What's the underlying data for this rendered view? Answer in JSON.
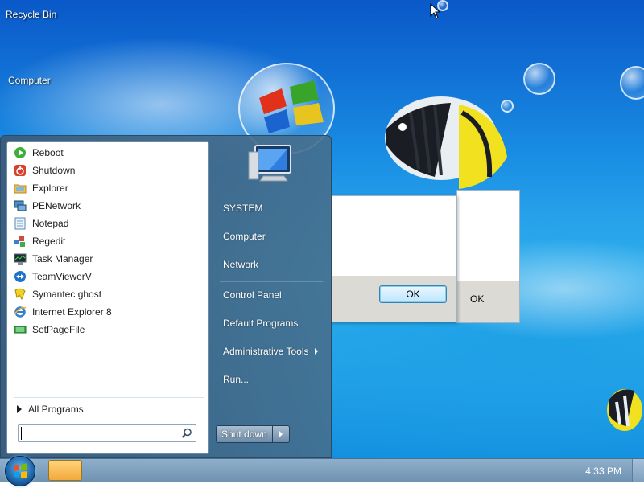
{
  "desktop": {
    "icons": [
      {
        "label": "Recycle Bin"
      },
      {
        "label": "Computer"
      }
    ]
  },
  "start_menu": {
    "programs": [
      {
        "label": "Reboot",
        "icon": "reboot-icon"
      },
      {
        "label": "Shutdown",
        "icon": "shutdown-icon"
      },
      {
        "label": "Explorer",
        "icon": "explorer-folder-icon"
      },
      {
        "label": "PENetwork",
        "icon": "network-icon"
      },
      {
        "label": "Notepad",
        "icon": "notepad-icon"
      },
      {
        "label": "Regedit",
        "icon": "regedit-icon"
      },
      {
        "label": "Task Manager",
        "icon": "task-manager-icon"
      },
      {
        "label": "TeamViewerV",
        "icon": "teamviewer-icon"
      },
      {
        "label": "Symantec ghost",
        "icon": "ghost-icon"
      },
      {
        "label": "Internet Explorer 8",
        "icon": "internet-explorer-icon"
      },
      {
        "label": "SetPageFile",
        "icon": "setpagefile-icon"
      }
    ],
    "all_programs_label": "All Programs",
    "search": {
      "value": "",
      "placeholder": ""
    },
    "right_items": {
      "system": "SYSTEM",
      "computer": "Computer",
      "network": "Network",
      "control_panel": "Control Panel",
      "default_programs": "Default Programs",
      "administrative_tools": "Administrative Tools",
      "run": "Run..."
    },
    "shutdown_label": "Shut down"
  },
  "dialogs": {
    "primary_ok": "OK",
    "secondary_ok": "OK"
  },
  "taskbar": {
    "clock": "4:33 PM"
  },
  "colors": {
    "desktop_blue": "#1a8fe4",
    "start_menu_glass": "#466e8c",
    "taskbar": "#7fa2c0"
  }
}
